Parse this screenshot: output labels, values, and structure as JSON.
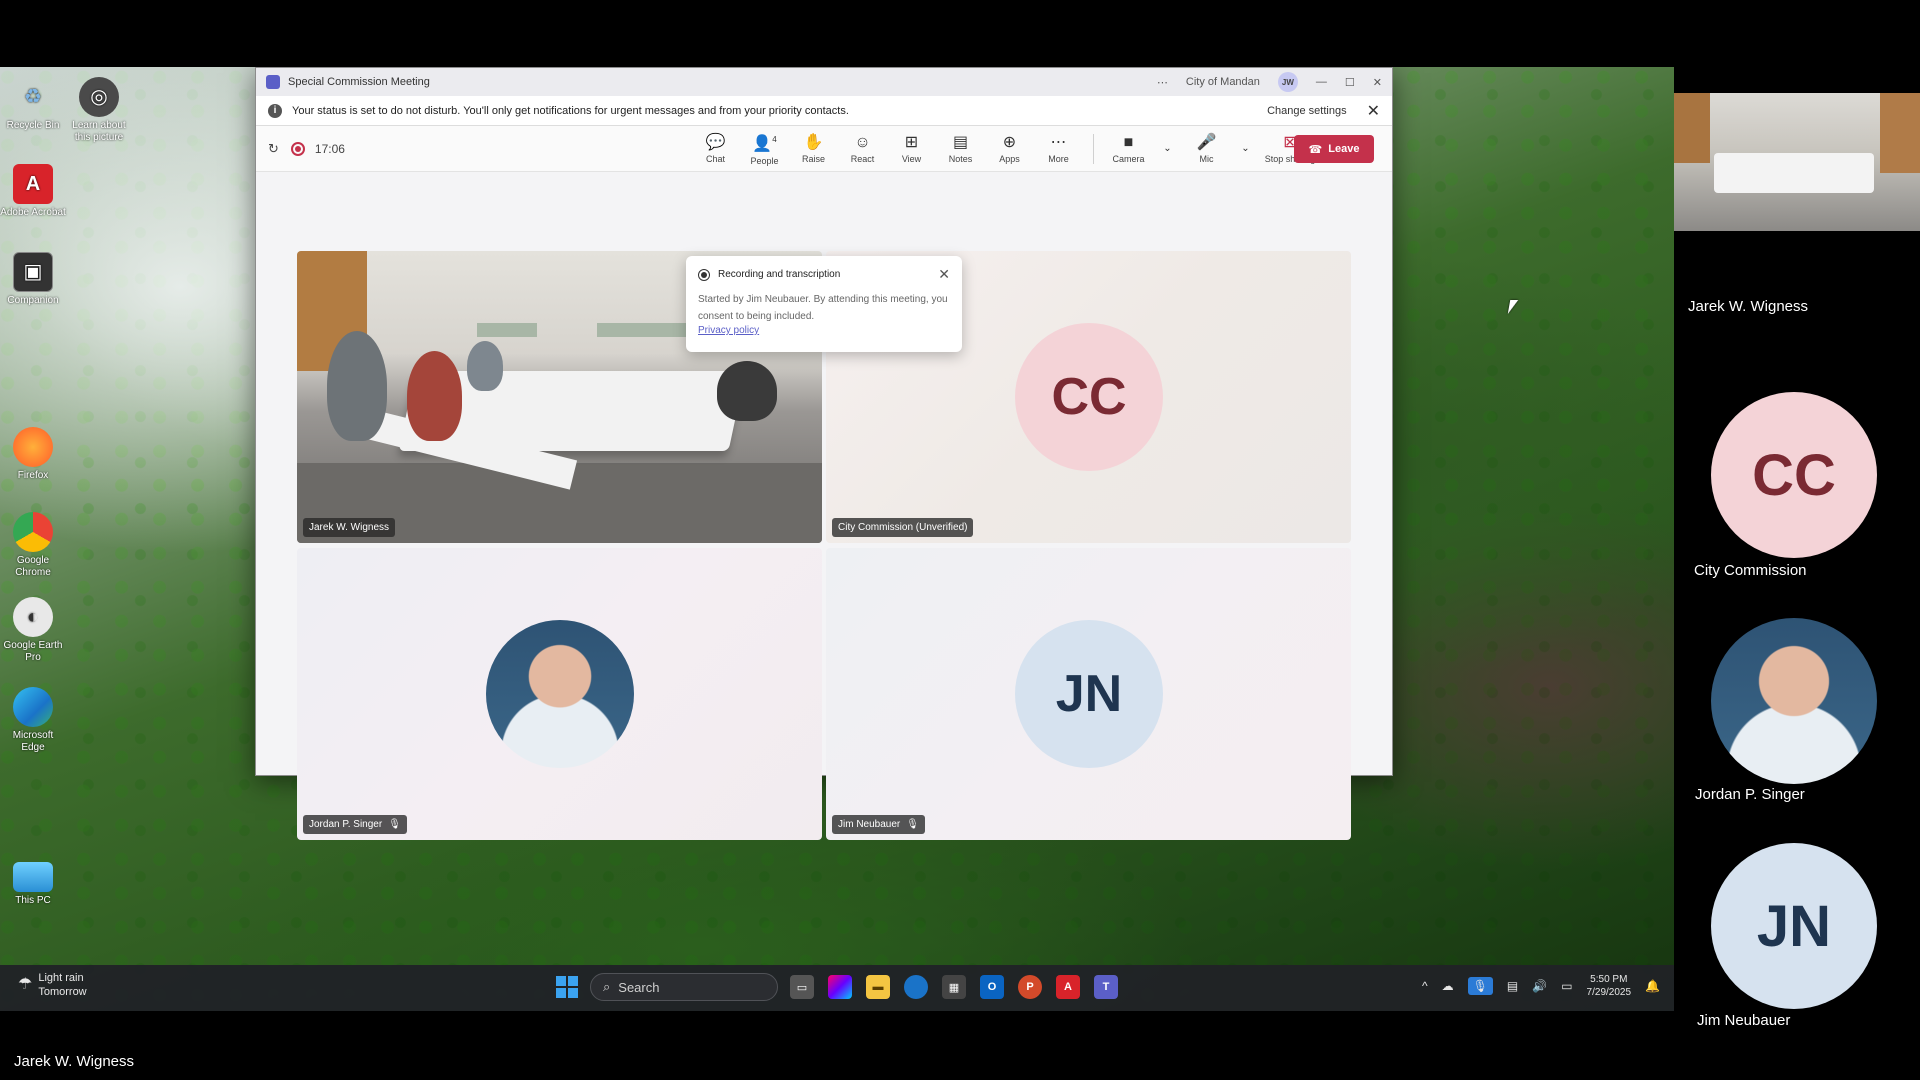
{
  "desktop": {
    "icons": [
      {
        "label": "Recycle Bin",
        "icon": "recycle-icon",
        "color": "#7fb6e6"
      },
      {
        "label": "Learn about this picture",
        "icon": "camera-icon",
        "color": "#5a5a5a"
      },
      {
        "label": "Adobe Acrobat",
        "icon": "acrobat-icon",
        "color": "#d8232a"
      },
      {
        "label": "Companion",
        "icon": "companion-icon",
        "color": "#3a3a3a"
      },
      {
        "label": "Firefox",
        "icon": "firefox-icon",
        "color": "#ff7139"
      },
      {
        "label": "Google Chrome",
        "icon": "chrome-icon",
        "color": "#34a853"
      },
      {
        "label": "Google Earth Pro",
        "icon": "earth-icon",
        "color": "#ececec"
      },
      {
        "label": "Microsoft Edge",
        "icon": "edge-icon",
        "color": "#1fa3d6"
      },
      {
        "label": "This PC",
        "icon": "monitor-icon",
        "color": "#4fb8f0"
      }
    ]
  },
  "teams": {
    "window_title": "Special Commission Meeting",
    "org": "City of Mandan",
    "user_initials": "JW",
    "banner_text": "Your status is set to do not disturb. You'll only get notifications for urgent messages and from your priority contacts.",
    "change_settings": "Change settings",
    "timer": "17:06",
    "people_count": "4",
    "tools": [
      {
        "label": "Chat",
        "glyph": "💬"
      },
      {
        "label": "People",
        "glyph": "👤"
      },
      {
        "label": "Raise",
        "glyph": "✋"
      },
      {
        "label": "React",
        "glyph": "☺"
      },
      {
        "label": "View",
        "glyph": "⊞"
      },
      {
        "label": "Notes",
        "glyph": "▤"
      },
      {
        "label": "Apps",
        "glyph": "⊕"
      },
      {
        "label": "More",
        "glyph": "⋯"
      }
    ],
    "media_tools": [
      {
        "label": "Camera",
        "glyph": "■"
      },
      {
        "label": "Mic",
        "glyph": "🎤"
      },
      {
        "label": "Stop sharing",
        "glyph": "⊠"
      }
    ],
    "leave_label": "Leave",
    "popup": {
      "title": "Recording and transcription",
      "body": "Started by Jim Neubauer. By attending this meeting, you consent to being included.",
      "link": "Privacy policy"
    },
    "tiles": [
      {
        "name": "Jarek W. Wigness"
      },
      {
        "name": "City Commission (Unverified)",
        "initials": "CC"
      },
      {
        "name": "Jordan P. Singer"
      },
      {
        "name": "Jim Neubauer",
        "initials": "JN"
      }
    ]
  },
  "taskbar": {
    "weather_line1": "Light rain",
    "weather_line2": "Tomorrow",
    "search_placeholder": "Search",
    "time": "5:50 PM",
    "date": "7/29/2025"
  },
  "right_panel": {
    "participants": [
      {
        "name": "Jarek W. Wigness"
      },
      {
        "name": "City Commission",
        "initials": "CC"
      },
      {
        "name": "Jordan P. Singer"
      },
      {
        "name": "Jim Neubauer",
        "initials": "JN"
      }
    ]
  },
  "footer_name": "Jarek W. Wigness"
}
